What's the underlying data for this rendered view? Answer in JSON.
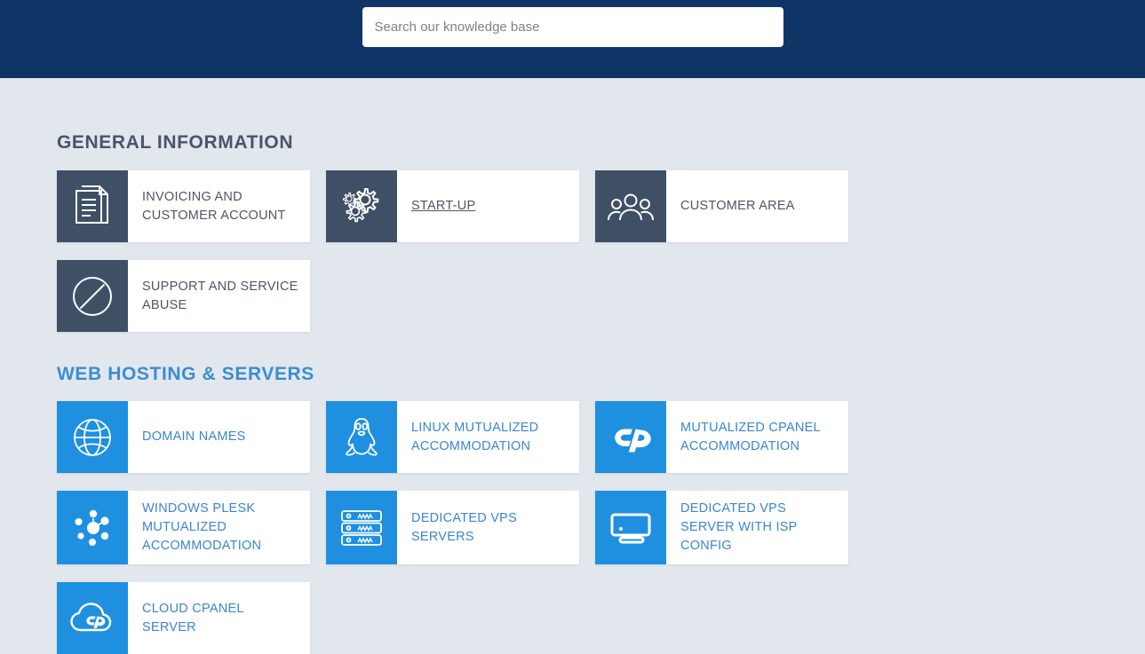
{
  "header": {
    "background_color": "#0f3567",
    "search": {
      "placeholder": "Search our knowledge base",
      "value": ""
    }
  },
  "page": {
    "background_color": "#e2e7ee"
  },
  "sections": [
    {
      "title": "GENERAL INFORMATION",
      "title_color": "#4a5568",
      "style": "dark",
      "icon_tile_color": "#3f4f66",
      "label_color": "#4e5665",
      "cards": [
        {
          "label": "INVOICING AND CUSTOMER ACCOUNT",
          "icon": "documents-icon",
          "hovered": false
        },
        {
          "label": "START-UP",
          "icon": "gears-icon",
          "hovered": true
        },
        {
          "label": "CUSTOMER AREA",
          "icon": "people-group-icon",
          "hovered": false
        },
        {
          "label": "SUPPORT AND SERVICE ABUSE",
          "icon": "ban-circle-slash-icon",
          "hovered": false
        }
      ]
    },
    {
      "title": "WEB HOSTING & SERVERS",
      "title_color": "#3a8ed0",
      "style": "blue",
      "icon_tile_color": "#1f90e0",
      "label_color": "#3a86cf",
      "cards": [
        {
          "label": "DOMAIN NAMES",
          "icon": "globe-icon",
          "hovered": false
        },
        {
          "label": "LINUX MUTUALIZED ACCOMMODATION",
          "icon": "linux-penguin-icon",
          "hovered": false
        },
        {
          "label": "MUTUALIZED CPANEL ACCOMMODATION",
          "icon": "cpanel-icon",
          "hovered": false
        },
        {
          "label": "WINDOWS PLESK MUTUALIZED ACCOMMODATION",
          "icon": "plesk-icon",
          "hovered": false
        },
        {
          "label": "DEDICATED VPS SERVERS",
          "icon": "server-rack-icon",
          "hovered": false
        },
        {
          "label": "DEDICATED VPS SERVER WITH ISP CONFIG",
          "icon": "monitor-icon",
          "hovered": false
        },
        {
          "label": "CLOUD CPANEL SERVER",
          "icon": "cloud-cpanel-icon",
          "hovered": false
        }
      ]
    }
  ]
}
